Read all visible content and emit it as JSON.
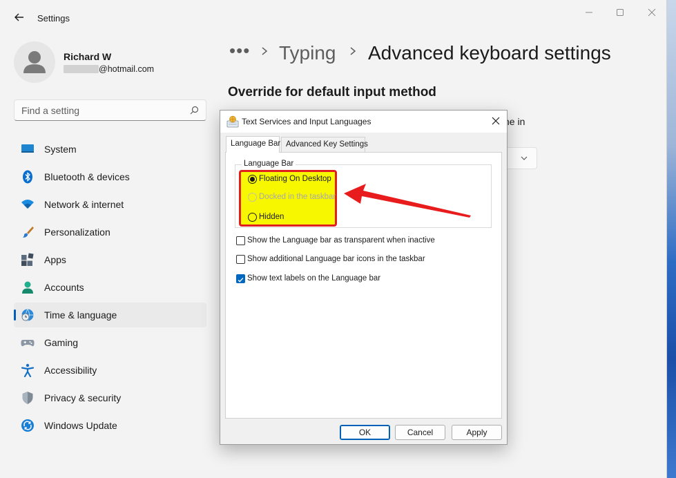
{
  "window": {
    "app_title": "Settings"
  },
  "profile": {
    "name": "Richard W",
    "email": "@hotmail.com"
  },
  "search": {
    "placeholder": "Find a setting"
  },
  "sidebar": {
    "items": [
      {
        "label": "System",
        "icon": "monitor-icon"
      },
      {
        "label": "Bluetooth & devices",
        "icon": "bluetooth-icon"
      },
      {
        "label": "Network & internet",
        "icon": "wifi-icon"
      },
      {
        "label": "Personalization",
        "icon": "brush-icon"
      },
      {
        "label": "Apps",
        "icon": "apps-icon"
      },
      {
        "label": "Accounts",
        "icon": "person-icon"
      },
      {
        "label": "Time & language",
        "icon": "globe-clock-icon",
        "selected": true
      },
      {
        "label": "Gaming",
        "icon": "gamepad-icon"
      },
      {
        "label": "Accessibility",
        "icon": "accessibility-icon"
      },
      {
        "label": "Privacy & security",
        "icon": "shield-icon"
      },
      {
        "label": "Windows Update",
        "icon": "update-icon"
      }
    ]
  },
  "main": {
    "breadcrumb_more": "•••",
    "breadcrumb_parent": "Typing",
    "page_title": "Advanced keyboard settings",
    "section_heading": "Override for default input method",
    "behind_text": "ne in"
  },
  "dialog": {
    "title": "Text Services and Input Languages",
    "tabs": [
      {
        "label": "Language Bar",
        "active": true
      },
      {
        "label": "Advanced Key Settings",
        "active": false
      }
    ],
    "group_label": "Language Bar",
    "radios": [
      {
        "label": "Floating On Desktop",
        "checked": true,
        "enabled": true
      },
      {
        "label": "Docked in the taskbar",
        "checked": false,
        "enabled": false
      },
      {
        "label": "Hidden",
        "checked": false,
        "enabled": true
      }
    ],
    "checkboxes": [
      {
        "label": "Show the Language bar as transparent when inactive",
        "checked": false
      },
      {
        "label": "Show additional Language bar icons in the taskbar",
        "checked": false
      },
      {
        "label": "Show text labels on the Language bar",
        "checked": true
      }
    ],
    "buttons": {
      "ok": "OK",
      "cancel": "Cancel",
      "apply": "Apply"
    }
  },
  "colors": {
    "accent": "#005fb8",
    "highlight_fill": "#f7f700",
    "highlight_border": "#e02020",
    "arrow": "#e81c1c"
  }
}
